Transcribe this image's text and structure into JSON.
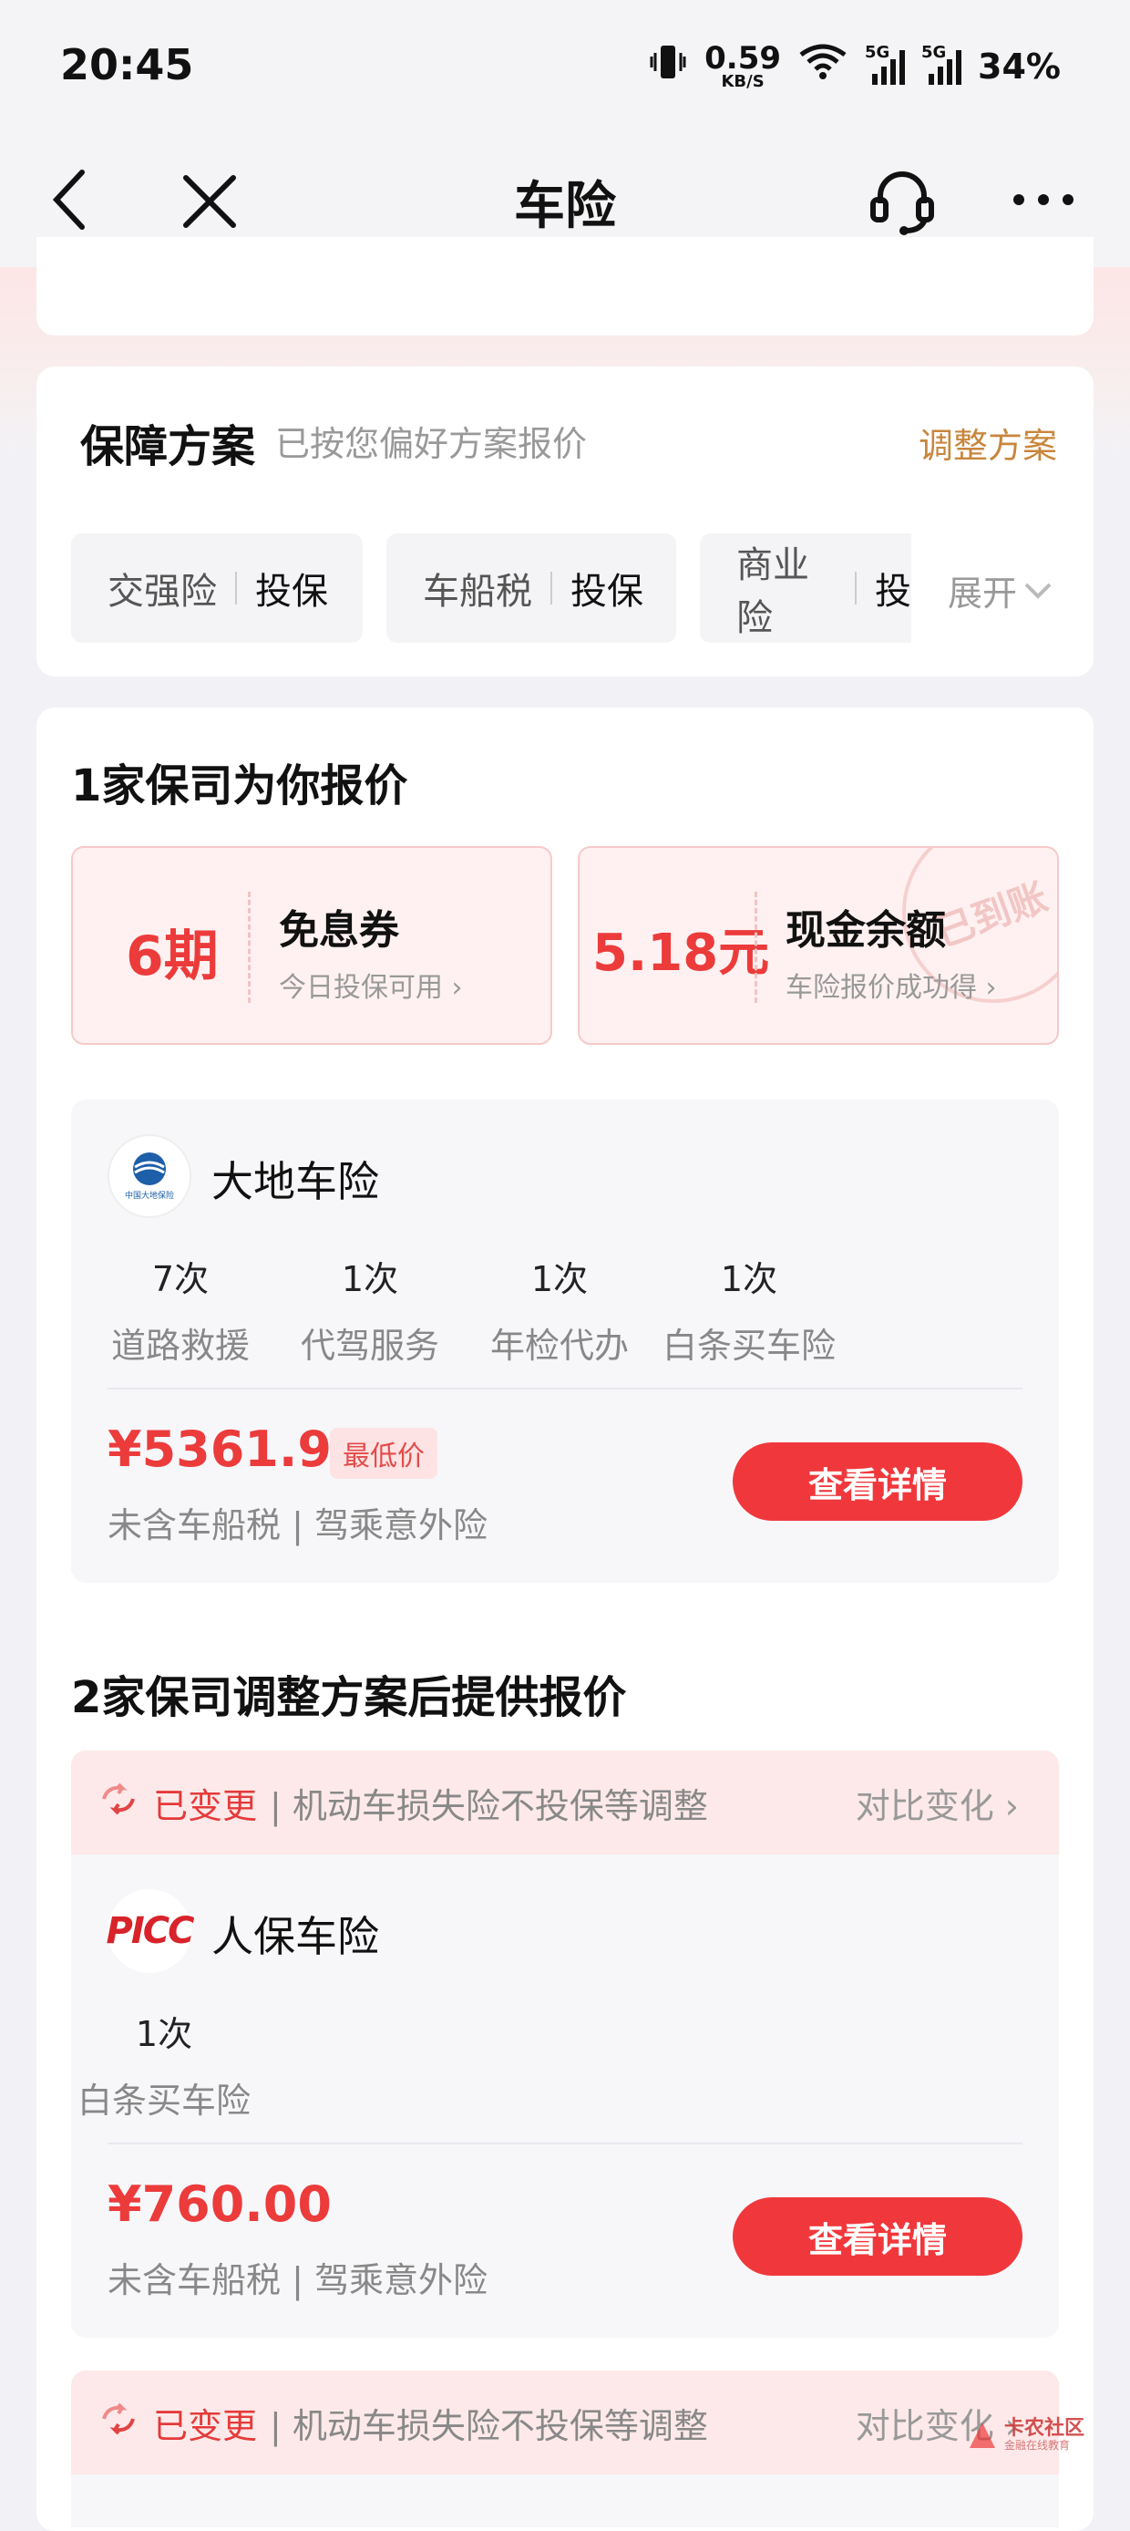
{
  "status": {
    "time": "20:45",
    "net_speed": "0.59",
    "net_unit": "KB/S",
    "sim1": "5G",
    "sim2": "5G",
    "battery": "34%"
  },
  "nav": {
    "title": "车险"
  },
  "plan": {
    "title": "保障方案",
    "subtitle": "已按您偏好方案报价",
    "adjust": "调整方案",
    "chips": [
      {
        "name": "交强险",
        "action": "投保"
      },
      {
        "name": "车船税",
        "action": "投保"
      },
      {
        "name": "商业险",
        "action": "投"
      }
    ],
    "expand": "展开"
  },
  "quotes": {
    "title": "1家保司为你报价",
    "coupon1": {
      "big": "6期",
      "title": "免息券",
      "sub": "今日投保可用"
    },
    "coupon2": {
      "big": "5.18元",
      "title": "现金余额",
      "sub": "车险报价成功得",
      "stamp": "已到账"
    },
    "offer1": {
      "insurer": "大地车险",
      "logo_text": "中国大地保险",
      "services": [
        {
          "count": "7次",
          "label": "道路救援"
        },
        {
          "count": "1次",
          "label": "代驾服务"
        },
        {
          "count": "1次",
          "label": "年检代办"
        },
        {
          "count": "1次",
          "label": "白条买车险"
        }
      ],
      "price": "¥5361.94",
      "badge": "最低价",
      "note": "未含车船税 | 驾乘意外险",
      "button": "查看详情"
    }
  },
  "adjusted": {
    "title": "2家保司调整方案后提供报价",
    "change_label": "已变更",
    "change_desc": "| 机动车损失险不投保等调整",
    "compare": "对比变化",
    "offer2": {
      "insurer": "人保车险",
      "logo_text": "PICC",
      "services": [
        {
          "count": "1次",
          "label": "白条买车险"
        }
      ],
      "price": "¥760.00",
      "note": "未含车船税 | 驾乘意外险",
      "button": "查看详情"
    },
    "change2_label": "已变更",
    "change2_desc": "| 机动车损失险不投保等调整",
    "compare2": "对比变化"
  },
  "watermark": {
    "text": "卡农社区",
    "sub": "金融在线教育"
  },
  "colors": {
    "accent": "#f0383c",
    "price": "#ec3b3b",
    "adjust": "#c8863c"
  }
}
